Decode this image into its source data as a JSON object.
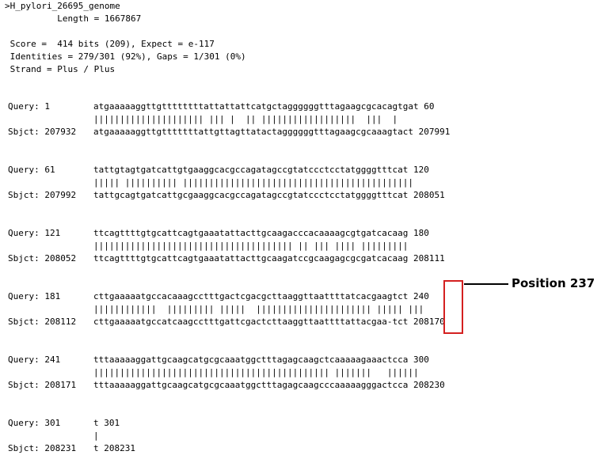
{
  "header": {
    "title": ">H_pylori_26695_genome",
    "length_line": "          Length = 1667867"
  },
  "stats": {
    "score_line": " Score =  414 bits (209), Expect = e-117",
    "identities_line": " Identities = 279/301 (92%), Gaps = 1/301 (0%)",
    "strand_line": " Strand = Plus / Plus"
  },
  "alignment": [
    {
      "query_label": "Query: 1",
      "query_seq": "atgaaaaaggttgttttttttattattattcatgctaggggggtttagaagcgcacagtgat 60",
      "match": "||||||||||||||||||||| ||| |  || ||||||||||||||||||  |||  |",
      "sbjct_label": "Sbjct: 207932",
      "sbjct_seq": "atgaaaaaggttgtttttttattgttagttatactaggggggtttagaagcgcaaagtact 207991"
    },
    {
      "query_label": "Query: 61",
      "query_seq": "tattgtagtgatcattgtgaaggcacgccagatagccgtatccctcctatggggtttcat 120",
      "match": "||||| |||||||||| ||||||||||||||||||||||||||||||||||||||||||||",
      "sbjct_label": "Sbjct: 207992",
      "sbjct_seq": "tattgcagtgatcattgcgaaggcacgccagatagccgtatccctcctatggggtttcat 208051"
    },
    {
      "query_label": "Query: 121",
      "query_seq": "ttcagttttgtgcattcagtgaaatattacttgcaagacccacaaaagcgtgatcacaag 180",
      "match": "|||||||||||||||||||||||||||||||||||||| || ||| |||| |||||||||",
      "sbjct_label": "Sbjct: 208052",
      "sbjct_seq": "ttcagttttgtgcattcagtgaaatattacttgcaagatccgcaagagcgcgatcacaag 208111"
    },
    {
      "query_label": "Query: 181",
      "query_seq": "cttgaaaaatgccacaaagcctttgactcgacgcttaaggttaattttatcacgaagtct 240",
      "match": "||||||||||||  ||||||||| |||||  |||||||||||||||||||||| ||||| |||",
      "sbjct_label": "Sbjct: 208112",
      "sbjct_seq": "cttgaaaaatgccatcaagcctttgattcgactcttaaggttaattttattacgaa-tct 208170"
    },
    {
      "query_label": "Query: 241",
      "query_seq": "tttaaaaaggattgcaagcatgcgcaaatggctttagagcaagctcaaaaagaaactcca 300",
      "match": "||||||||||||||||||||||||||||||||||||||||||||| |||||||   ||||||",
      "sbjct_label": "Sbjct: 208171",
      "sbjct_seq": "tttaaaaaggattgcaagcatgcgcaaatggctttagagcaagcccaaaaagggactcca 208230"
    },
    {
      "query_label": "Query: 301",
      "query_seq": "t 301",
      "match": "|",
      "sbjct_label": "Sbjct: 208231",
      "sbjct_seq": "t 208231"
    }
  ],
  "annotation": {
    "label": "Position 237",
    "box_color": "#d42020"
  }
}
